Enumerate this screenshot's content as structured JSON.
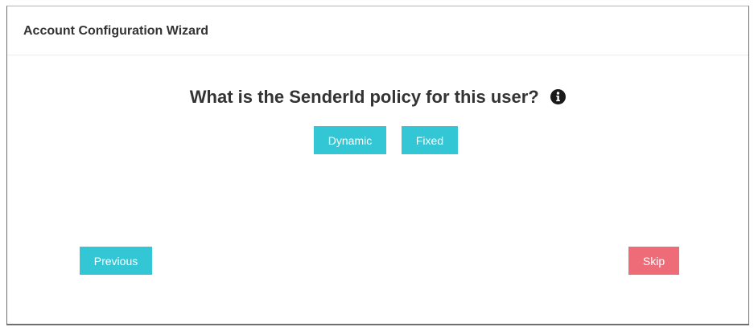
{
  "wizard": {
    "title": "Account Configuration Wizard",
    "question": "What is the SenderId policy for this user?",
    "info_icon": "info-circle-icon",
    "options": {
      "dynamic_label": "Dynamic",
      "fixed_label": "Fixed"
    },
    "nav": {
      "previous_label": "Previous",
      "skip_label": "Skip"
    }
  },
  "colors": {
    "info_button": "#33c6d4",
    "skip_button": "#ed6c78",
    "text": "#333333"
  }
}
